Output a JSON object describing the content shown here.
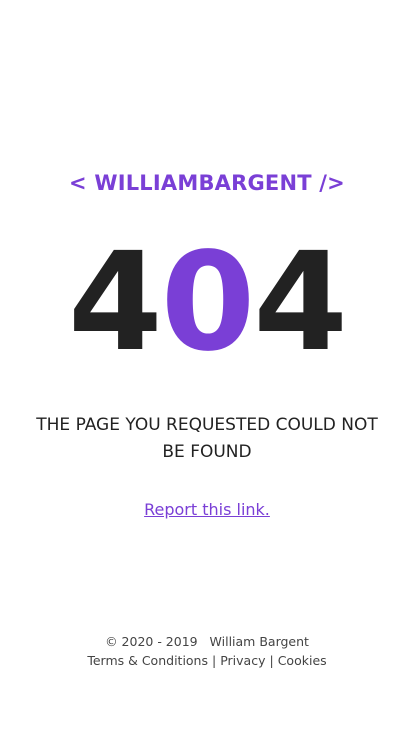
{
  "header": {
    "brand": "< WILLIAMBARGENT />"
  },
  "error": {
    "digit_1": "4",
    "digit_2": "0",
    "digit_3": "4"
  },
  "message": "THE PAGE YOU REQUESTED COULD NOT BE FOUND",
  "report_link": "Report this link.",
  "footer": {
    "copyright": "© 2020 - 2019",
    "owner": "William Bargent",
    "separator": "|",
    "links": {
      "terms": "Terms & Conditions",
      "privacy": "Privacy",
      "cookies": "Cookies"
    }
  },
  "colors": {
    "accent": "#7a3fd6",
    "text": "#222222"
  }
}
